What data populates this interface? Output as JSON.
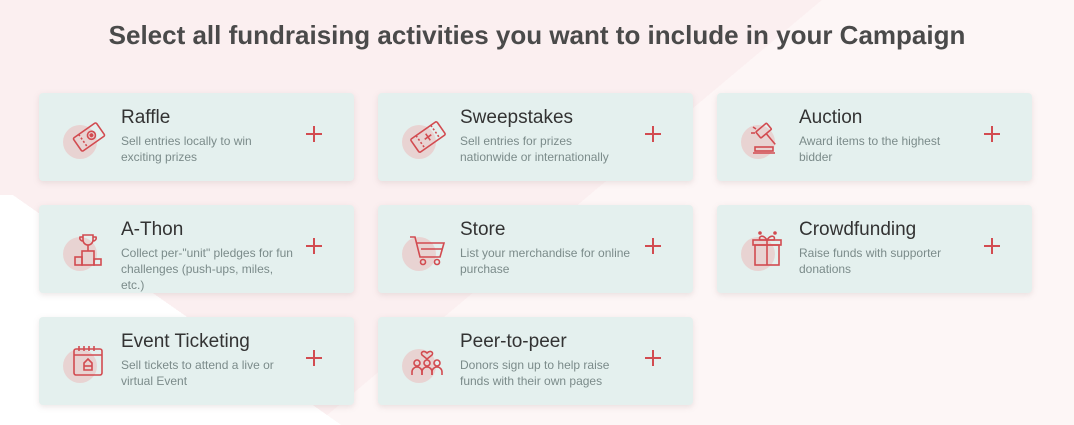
{
  "header": {
    "title": "Select all fundraising activities you want to include in your Campaign"
  },
  "colors": {
    "accent": "#d24b50",
    "card_bg": "#e4f0ee",
    "page_bg": "#fbeff0"
  },
  "activities": [
    {
      "title": "Raffle",
      "desc": "Sell entries locally to win exciting prizes",
      "icon": "raffle-ticket-icon"
    },
    {
      "title": "Sweepstakes",
      "desc": "Sell entries for prizes nationwide or internationally",
      "icon": "sweepstakes-ticket-icon"
    },
    {
      "title": "Auction",
      "desc": "Award items to the highest bidder",
      "icon": "gavel-icon"
    },
    {
      "title": "A-Thon",
      "desc": "Collect per-\"unit\" pledges for fun challenges (push-ups, miles, etc.)",
      "icon": "trophy-podium-icon"
    },
    {
      "title": "Store",
      "desc": "List your merchandise for online purchase",
      "icon": "shopping-cart-icon"
    },
    {
      "title": "Crowdfunding",
      "desc": "Raise funds with supporter donations",
      "icon": "gift-box-icon"
    },
    {
      "title": "Event Ticketing",
      "desc": "Sell tickets to attend a live or virtual Event",
      "icon": "calendar-ticket-icon"
    },
    {
      "title": "Peer-to-peer",
      "desc": "Donors sign up to help raise funds with their own pages",
      "icon": "people-heart-icon"
    }
  ]
}
